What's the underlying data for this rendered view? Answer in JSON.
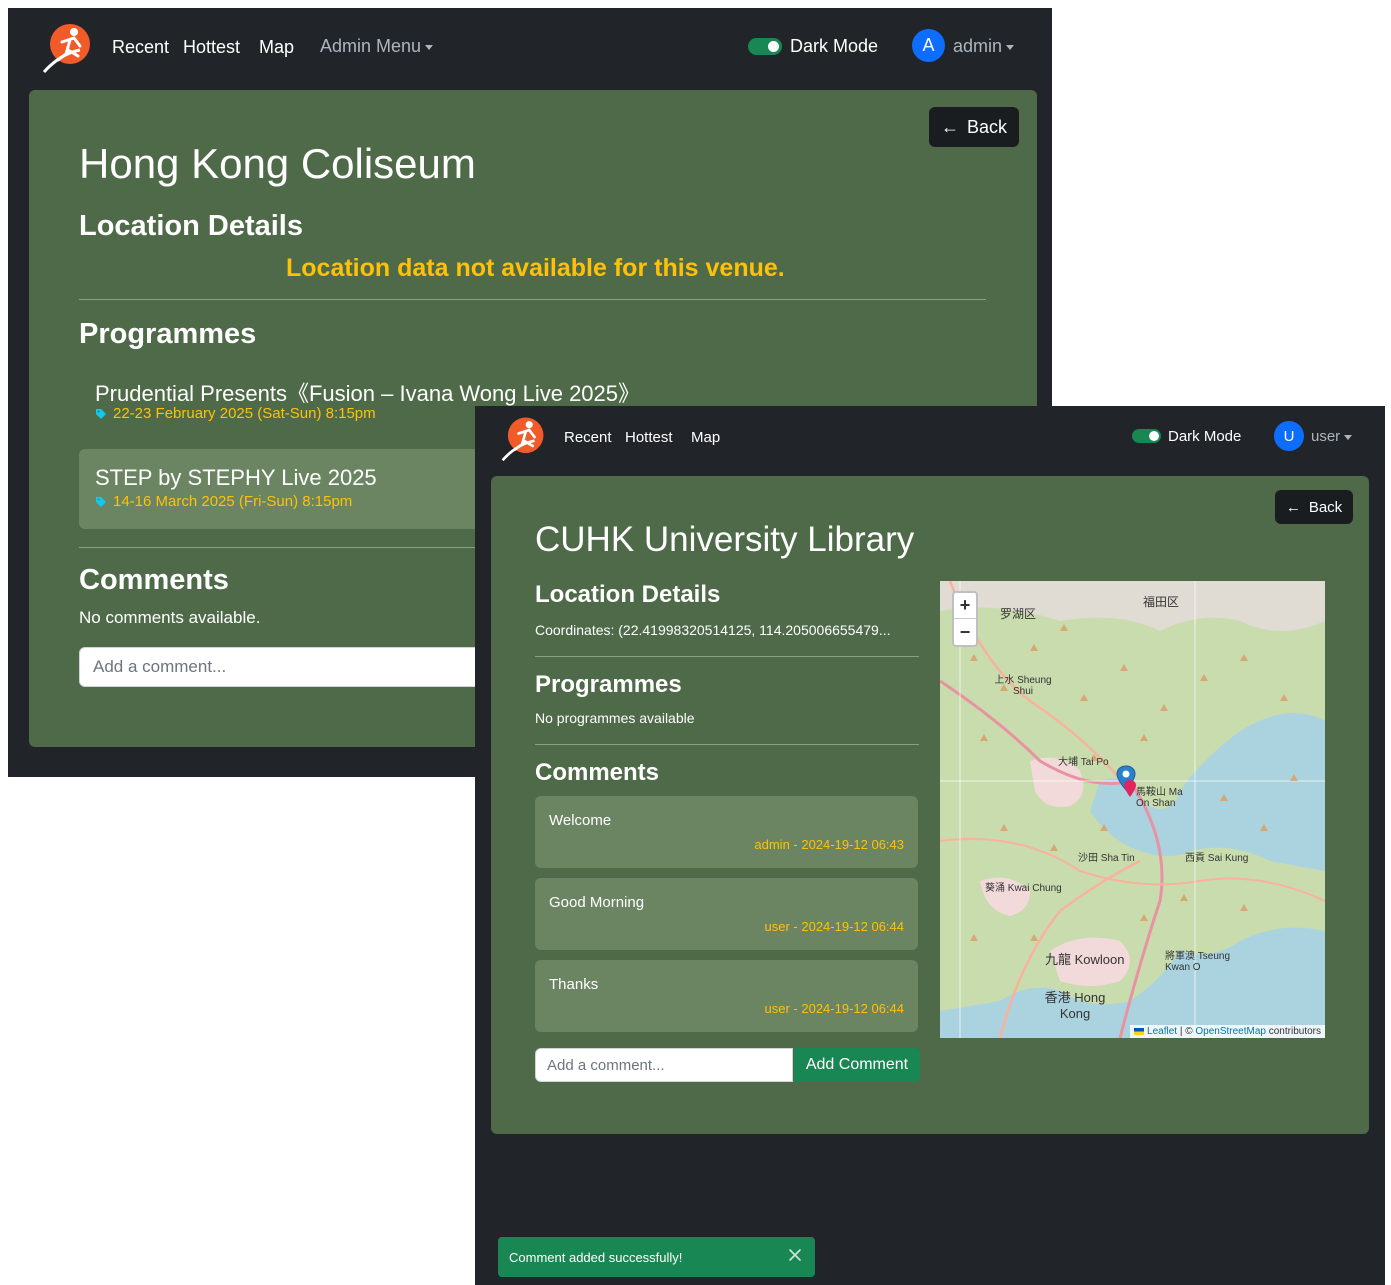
{
  "window_back": {
    "nav": {
      "recent": "Recent",
      "hottest": "Hottest",
      "map": "Map",
      "admin_menu": "Admin Menu",
      "dark_mode": "Dark Mode",
      "avatar_letter": "A",
      "username": "admin"
    },
    "back_label": "Back",
    "venue_title": "Hong Kong Coliseum",
    "location_heading": "Location Details",
    "location_warning": "Location data not available for this venue.",
    "programmes_heading": "Programmes",
    "programmes": [
      {
        "title": "Prudential Presents《Fusion – Ivana Wong Live 2025》",
        "date": "22-23 February 2025 (Sat-Sun) 8:15pm"
      },
      {
        "title": "STEP by STEPHY Live 2025",
        "date": "14-16 March 2025 (Fri-Sun) 8:15pm"
      }
    ],
    "comments_heading": "Comments",
    "no_comments": "No comments available.",
    "comment_placeholder": "Add a comment..."
  },
  "window_front": {
    "nav": {
      "recent": "Recent",
      "hottest": "Hottest",
      "map": "Map",
      "dark_mode": "Dark Mode",
      "avatar_letter": "U",
      "username": "user"
    },
    "back_label": "Back",
    "venue_title": "CUHK University Library",
    "location_heading": "Location Details",
    "coordinates": "Coordinates: (22.41998320514125, 114.205006655479...",
    "programmes_heading": "Programmes",
    "no_programmes": "No programmes available",
    "comments_heading": "Comments",
    "comments": [
      {
        "text": "Welcome",
        "meta": "admin - 2024-19-12 06:43"
      },
      {
        "text": "Good Morning",
        "meta": "user - 2024-19-12 06:44"
      },
      {
        "text": "Thanks",
        "meta": "user - 2024-19-12 06:44"
      }
    ],
    "comment_placeholder": "Add a comment...",
    "add_comment_label": "Add Comment",
    "map": {
      "zoom_in": "+",
      "zoom_out": "−",
      "attribution_leaflet": "Leaflet",
      "attribution_sep": " | © ",
      "attribution_osm": "OpenStreetMap",
      "attribution_tail": " contributors",
      "labels": {
        "lo_wu": "罗湖区",
        "futian": "福田区",
        "sheung_shui": "上水 Sheung Shui",
        "tai_po": "大埔 Tai Po",
        "ma_on_shan": "馬鞍山 Ma On Shan",
        "sha_tin": "沙田 Sha Tin",
        "sai_kung": "西貢 Sai Kung",
        "kwai_chung": "葵涌 Kwai Chung",
        "kowloon": "九龍 Kowloon",
        "tseung_kwan_o": "將軍澳 Tseung Kwan O",
        "hong_kong": "香港 Hong Kong"
      }
    },
    "toast": "Comment added successfully!"
  },
  "colors": {
    "navbar_bg": "#212529",
    "panel_bg": "#4e6a48",
    "accent_yellow": "#ffc107",
    "success_green": "#198754",
    "avatar_blue": "#0d6efd"
  }
}
